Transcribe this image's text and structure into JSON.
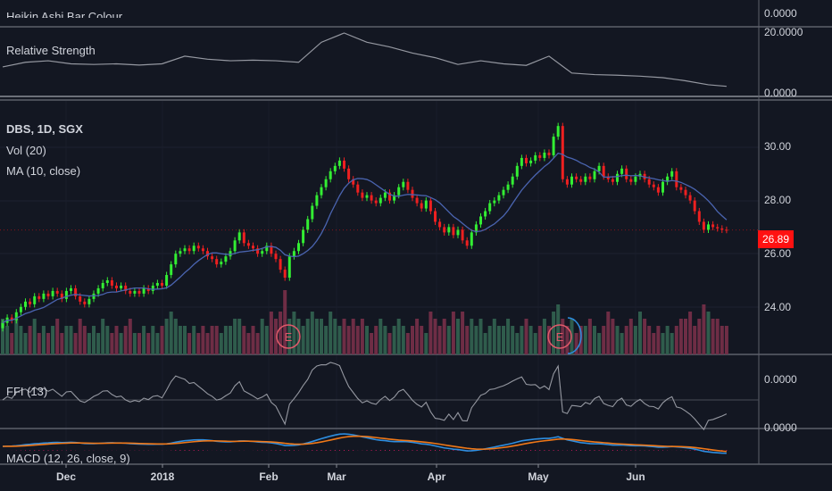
{
  "panes": {
    "heikin_title": "Heikin Ashi Bar Colour",
    "heikin_axis": "0.0000",
    "rs_title": "Relative Strength",
    "rs_axis_top": "20.0000",
    "rs_axis_bottom": "0.0000",
    "main_symbol": "DBS, 1D, SGX",
    "vol_title": "Vol (20)",
    "ma_title": "MA (10, close)",
    "ffi_title": "FFI (13)",
    "ffi_axis": "0.0000",
    "macd_title": "MACD (12, 26, close, 9)",
    "macd_axis": "0.0000"
  },
  "earnings_marker": "E",
  "colors": {
    "background": "#131722",
    "up": "#33ee33",
    "down": "#ee2020",
    "vol_up": "#2f5c4c",
    "vol_down": "#6e2d45",
    "ma": "#4a64b0",
    "last_price": "#ff1111",
    "macd": "#2e8ee0",
    "signal": "#f07818",
    "hist": "#c2185b",
    "line": "#9598a1"
  },
  "chart_data": {
    "type": "candlestick",
    "symbol": "DBS",
    "interval": "1D",
    "exchange": "SGX",
    "price_axis_ticks": [
      "30.00",
      "28.00",
      "26.00",
      "24.00"
    ],
    "ylim": [
      23.2,
      31.7
    ],
    "last_price": "26.89",
    "time_ticks": [
      "Dec",
      "2018",
      "Feb",
      "Mar",
      "Apr",
      "May",
      "Jun"
    ],
    "close": [
      23.4,
      23.6,
      23.5,
      23.8,
      24.0,
      24.2,
      24.1,
      24.4,
      24.3,
      24.5,
      24.4,
      24.6,
      24.5,
      24.3,
      24.6,
      24.7,
      24.4,
      24.2,
      24.1,
      24.3,
      24.5,
      24.7,
      24.9,
      25.0,
      24.8,
      24.7,
      24.8,
      24.6,
      24.5,
      24.6,
      24.5,
      24.7,
      24.6,
      24.8,
      24.9,
      24.8,
      25.2,
      25.6,
      26.0,
      26.1,
      26.2,
      26.1,
      26.3,
      26.2,
      26.1,
      25.9,
      25.8,
      25.6,
      25.7,
      25.9,
      26.1,
      26.5,
      26.8,
      26.4,
      26.3,
      26.2,
      26.0,
      26.1,
      26.3,
      26.0,
      25.8,
      25.4,
      25.1,
      25.9,
      26.1,
      26.4,
      26.9,
      27.3,
      27.8,
      28.2,
      28.5,
      28.8,
      29.1,
      29.3,
      29.5,
      29.2,
      28.8,
      28.6,
      28.3,
      28.1,
      28.2,
      28.0,
      27.9,
      28.1,
      28.3,
      28.0,
      28.2,
      28.5,
      28.7,
      28.4,
      28.1,
      27.9,
      27.7,
      28.0,
      27.6,
      27.2,
      27.0,
      26.8,
      27.0,
      26.7,
      26.9,
      26.5,
      26.3,
      26.8,
      27.1,
      27.4,
      27.6,
      27.9,
      28.0,
      28.2,
      28.4,
      28.6,
      28.9,
      29.3,
      29.6,
      29.4,
      29.5,
      29.7,
      29.6,
      29.8,
      29.7,
      30.4,
      30.8,
      28.8,
      28.6,
      28.9,
      28.8,
      28.7,
      28.9,
      28.8,
      29.1,
      29.3,
      28.9,
      28.8,
      28.7,
      29.0,
      29.2,
      28.8,
      28.7,
      28.9,
      29.0,
      28.8,
      28.6,
      28.5,
      28.3,
      28.7,
      28.9,
      29.1,
      28.5,
      28.4,
      28.2,
      28.0,
      27.6,
      27.2,
      26.9,
      27.1,
      27.0,
      26.95,
      26.9,
      26.89
    ],
    "volume": [
      5,
      4,
      3,
      5,
      4,
      3,
      4,
      5,
      3,
      4,
      3,
      4,
      5,
      3,
      4,
      4,
      3,
      5,
      4,
      3,
      4,
      3,
      5,
      4,
      3,
      4,
      3,
      4,
      5,
      3,
      3,
      4,
      3,
      4,
      3,
      4,
      5,
      6,
      5,
      4,
      4,
      3,
      4,
      3,
      4,
      3,
      4,
      4,
      3,
      4,
      4,
      5,
      5,
      4,
      3,
      4,
      3,
      5,
      4,
      6,
      5,
      6,
      9,
      5,
      6,
      5,
      4,
      5,
      6,
      5,
      5,
      4,
      6,
      5,
      4,
      5,
      4,
      5,
      4,
      5,
      4,
      3,
      4,
      5,
      4,
      3,
      4,
      5,
      4,
      3,
      4,
      5,
      4,
      3,
      6,
      5,
      4,
      5,
      4,
      6,
      5,
      6,
      4,
      5,
      4,
      5,
      3,
      4,
      5,
      4,
      4,
      5,
      4,
      3,
      4,
      5,
      4,
      3,
      4,
      5,
      4,
      6,
      7,
      5,
      4,
      5,
      3,
      4,
      4,
      5,
      4,
      3,
      4,
      6,
      5,
      4,
      3,
      4,
      5,
      4,
      6,
      5,
      4,
      3,
      4,
      3,
      4,
      3,
      4,
      5,
      5,
      6,
      4,
      5,
      7,
      6,
      5,
      5,
      4,
      4
    ],
    "relative_strength": [
      9.0,
      10.5,
      11.0,
      10.0,
      9.8,
      10.0,
      9.6,
      10.0,
      12.5,
      11.5,
      11.0,
      11.2,
      11.0,
      10.5,
      17.0,
      20.0,
      17.0,
      15.5,
      13.5,
      12.0,
      9.8,
      11.0,
      10.0,
      9.5,
      12.5,
      7.0,
      6.5,
      6.3,
      6.0,
      5.5,
      4.5,
      3.2,
      2.7
    ],
    "rs_ylim": [
      0,
      20
    ],
    "ma_period": 10
  }
}
